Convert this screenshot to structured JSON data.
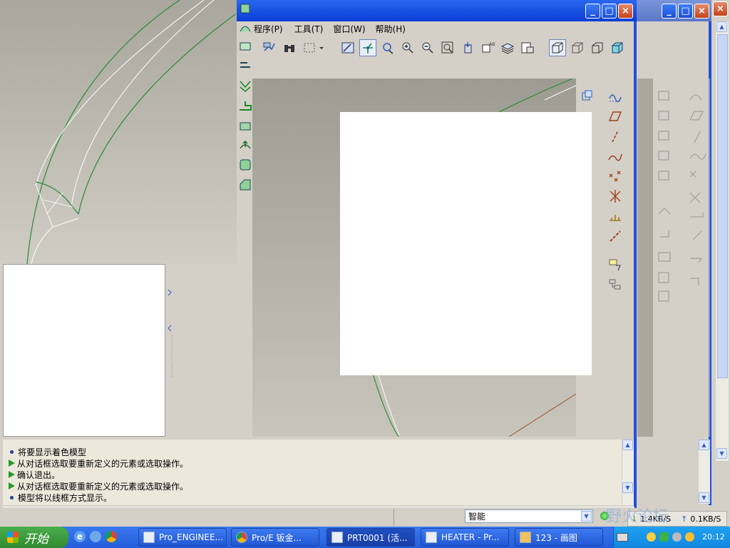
{
  "main_window": {
    "menu": [
      {
        "label": "程序(P)",
        "visible": "程序(P)"
      },
      {
        "label": "工具(T)"
      },
      {
        "label": "窗口(W)"
      },
      {
        "label": "帮助(H)"
      }
    ],
    "menu_texts": [
      "程序(P)",
      "工具(T)",
      "窗口(W)",
      "帮助(H)"
    ]
  },
  "messages": [
    {
      "kind": "info",
      "text": "将要显示着色模型"
    },
    {
      "kind": "prompt",
      "text": "从对话框选取要重新定义的元素或选取操作。"
    },
    {
      "kind": "prompt",
      "text": "确认退出。"
    },
    {
      "kind": "prompt",
      "text": "从对话框选取要重新定义的元素或选取操作。"
    },
    {
      "kind": "info",
      "text": "模型将以线框方式显示。"
    }
  ],
  "status": {
    "filter_value": "智能",
    "download_speed": "1.4KB/S",
    "upload_speed": "0.1KB/S",
    "watermark": "野火论坛"
  },
  "taskbar": {
    "start_label": "开始",
    "items": [
      {
        "label": "Pro_ENGINEE..."
      },
      {
        "label": "Pro/E 钣金..."
      },
      {
        "label": "PRT0001 (活..."
      },
      {
        "label": "HEATER - Pr..."
      },
      {
        "label": "123 - 画图"
      }
    ],
    "clock": "20:12"
  },
  "title_buttons": {
    "minimize": "_",
    "maximize": "□",
    "close": "×"
  },
  "colors": {
    "titlebar_blue": "#0a3fd6",
    "window_frame": "#2150d8",
    "workspace_gray": "#aaa89c",
    "model_green": "#2a8a3a",
    "taskbar_blue": "#245edb",
    "start_green": "#3c9a3c"
  }
}
